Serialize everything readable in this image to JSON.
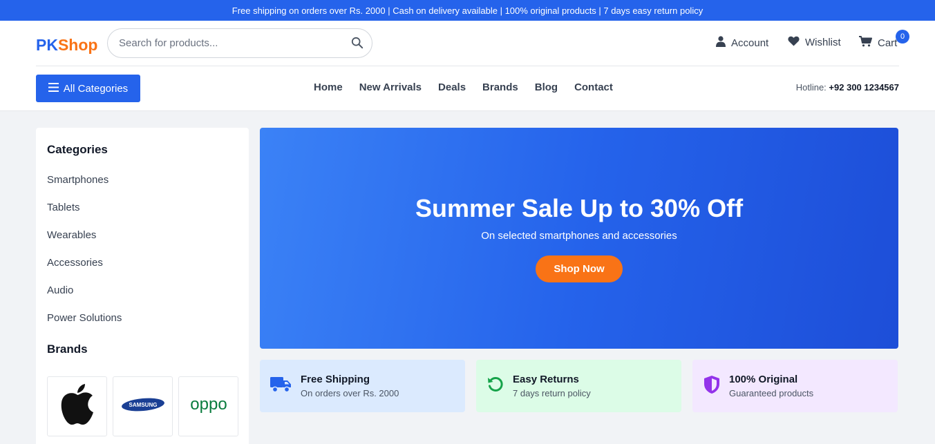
{
  "topbar": {
    "text": "Free shipping on orders over Rs. 2000 | Cash on delivery available | 100% original products | 7 days easy return policy"
  },
  "header": {
    "logo_part1": "PK",
    "logo_part2": "Shop",
    "search_placeholder": "Search for products...",
    "account_label": "Account",
    "wishlist_label": "Wishlist",
    "cart_label": "Cart",
    "cart_count": "0"
  },
  "nav": {
    "all_categories_label": "All Categories",
    "links": [
      "Home",
      "New Arrivals",
      "Deals",
      "Brands",
      "Blog",
      "Contact"
    ],
    "hotline_label": "Hotline:",
    "hotline_number": "+92 300 1234567"
  },
  "sidebar": {
    "categories_title": "Categories",
    "categories": [
      "Smartphones",
      "Tablets",
      "Wearables",
      "Accessories",
      "Audio",
      "Power Solutions"
    ],
    "brands_title": "Brands",
    "brands": [
      {
        "name": "Apple",
        "icon": "apple-logo"
      },
      {
        "name": "SAMSUNG",
        "icon": "samsung-logo"
      },
      {
        "name": "oppo",
        "icon": "oppo-logo"
      }
    ]
  },
  "hero": {
    "title": "Summer Sale Up to 30% Off",
    "subtitle": "On selected smartphones and accessories",
    "cta": "Shop Now"
  },
  "features": [
    {
      "title": "Free Shipping",
      "subtitle": "On orders over Rs. 2000",
      "icon": "truck-icon"
    },
    {
      "title": "Easy Returns",
      "subtitle": "7 days return policy",
      "icon": "return-icon"
    },
    {
      "title": "100% Original",
      "subtitle": "Guaranteed products",
      "icon": "shield-icon"
    }
  ],
  "colors": {
    "primary": "#2563eb",
    "accent": "#f97316",
    "feature_blue_bg": "#dbeafe",
    "feature_green_bg": "#dcfce7",
    "feature_purple_bg": "#f3e8ff"
  }
}
